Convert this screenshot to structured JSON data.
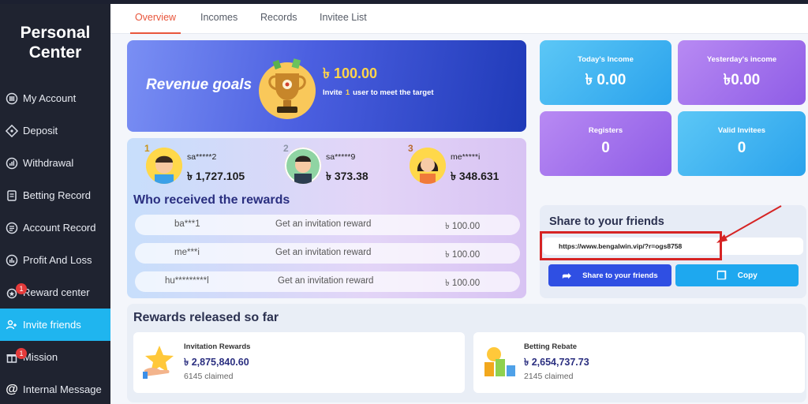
{
  "sidebar": {
    "title_line1": "Personal",
    "title_line2": "Center",
    "items": [
      {
        "label": "My Account",
        "icon": "account-icon"
      },
      {
        "label": "Deposit",
        "icon": "deposit-icon"
      },
      {
        "label": "Withdrawal",
        "icon": "withdrawal-icon"
      },
      {
        "label": "Betting Record",
        "icon": "betting-record-icon"
      },
      {
        "label": "Account Record",
        "icon": "account-record-icon"
      },
      {
        "label": "Profit And Loss",
        "icon": "profit-loss-icon"
      },
      {
        "label": "Reward center",
        "icon": "reward-icon",
        "badge": "1"
      },
      {
        "label": "Invite friends",
        "icon": "invite-icon",
        "active": true
      },
      {
        "label": "Mission",
        "icon": "mission-icon",
        "badge": "1"
      },
      {
        "label": "Internal Message",
        "icon": "message-icon"
      }
    ]
  },
  "tabs": [
    {
      "label": "Overview",
      "active": true
    },
    {
      "label": "Incomes"
    },
    {
      "label": "Records"
    },
    {
      "label": "Invitee List"
    }
  ],
  "goals": {
    "title": "Revenue goals",
    "amount": "৳ 100.00",
    "sub_prefix": "Invite",
    "sub_num": "1",
    "sub_suffix": "user to meet the target"
  },
  "rankings": [
    {
      "medal": "1",
      "name": "sa*****2",
      "amount": "৳ 1,727.105"
    },
    {
      "medal": "2",
      "name": "sa*****9",
      "amount": "৳ 373.38"
    },
    {
      "medal": "3",
      "name": "me*****i",
      "amount": "৳ 348.631"
    }
  ],
  "who_title": "Who received the rewards",
  "reward_rows": [
    {
      "user": "ba***1",
      "desc": "Get an invitation reward",
      "amount": "৳ 100.00"
    },
    {
      "user": "me***i",
      "desc": "Get an invitation reward",
      "amount": "৳ 100.00"
    },
    {
      "user": "hu*********l",
      "desc": "Get an invitation reward",
      "amount": "৳ 100.00"
    }
  ],
  "stats": {
    "today_label": "Today's Income",
    "today_value": "৳ 0.00",
    "yesterday_label": "Yesterday's income",
    "yesterday_value": "৳0.00",
    "registers_label": "Registers",
    "registers_value": "0",
    "valid_label": "Valid Invitees",
    "valid_value": "0"
  },
  "share": {
    "title": "Share to your friends",
    "link": "https://www.bengalwin.vip/?r=ogs8758",
    "share_button": "Share to your friends",
    "copy_button": "Copy"
  },
  "released": {
    "title": "Rewards released so far",
    "invitation_label": "Invitation Rewards",
    "invitation_amount": "৳ 2,875,840.60",
    "invitation_claimed": "6145 claimed",
    "rebate_label": "Betting Rebate",
    "rebate_amount": "৳ 2,654,737.73",
    "rebate_claimed": "2145 claimed"
  },
  "colors": {
    "accent_tab": "#e8553b",
    "sidebar_active": "#1fb5ef",
    "annotation_red": "#d62424"
  }
}
